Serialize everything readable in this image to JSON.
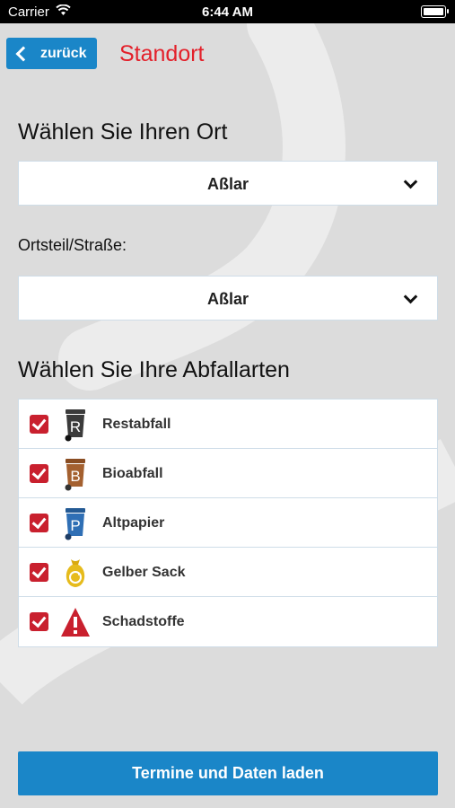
{
  "status_bar": {
    "carrier": "Carrier",
    "time": "6:44 AM"
  },
  "nav": {
    "back_label": "zurück",
    "title": "Standort"
  },
  "location": {
    "heading": "Wählen Sie Ihren Ort",
    "place_value": "Aßlar",
    "district_label": "Ortsteil/Straße:",
    "district_value": "Aßlar"
  },
  "waste": {
    "heading": "Wählen Sie Ihre Abfallarten",
    "items": [
      {
        "label": "Restabfall",
        "checked": true,
        "icon": "restabfall-bin-icon",
        "color": "#3b3b3b"
      },
      {
        "label": "Bioabfall",
        "checked": true,
        "icon": "bioabfall-bin-icon",
        "color": "#a4602f"
      },
      {
        "label": "Altpapier",
        "checked": true,
        "icon": "altpapier-bin-icon",
        "color": "#2f6fb5"
      },
      {
        "label": "Gelber Sack",
        "checked": true,
        "icon": "gelber-sack-icon",
        "color": "#e0b418"
      },
      {
        "label": "Schadstoffe",
        "checked": true,
        "icon": "schadstoffe-warning-icon",
        "color": "#c9202e"
      }
    ]
  },
  "cta": {
    "label": "Termine und Daten laden"
  },
  "colors": {
    "accent": "#1a86c8",
    "title_red": "#e3202a",
    "checkbox_red": "#c9202e"
  }
}
